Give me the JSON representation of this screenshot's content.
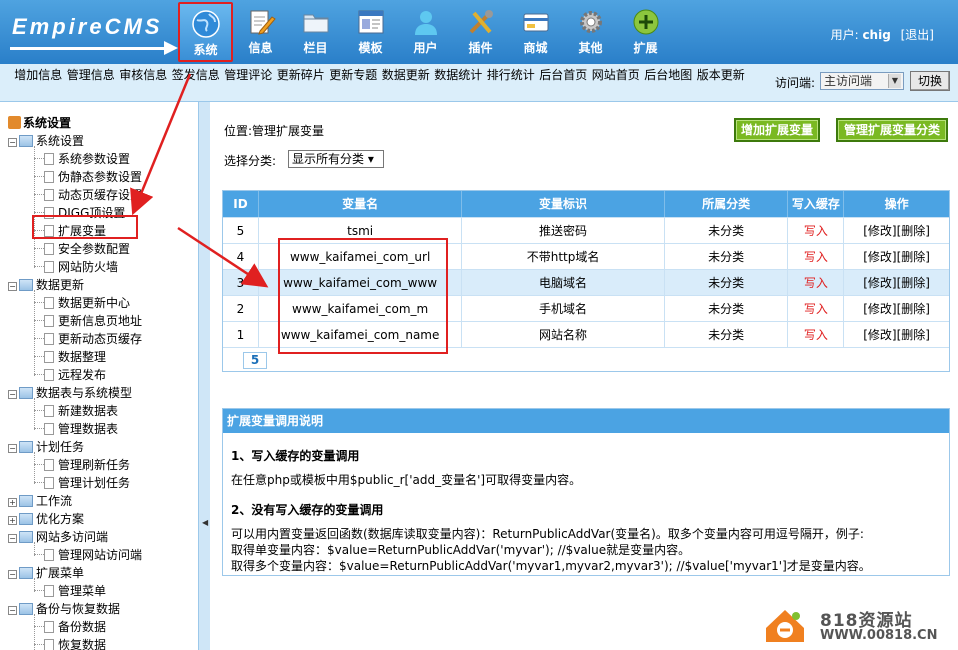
{
  "header": {
    "logo_text": "EmpireCMS",
    "nav": [
      {
        "label": "系统",
        "icon": "globe-icon",
        "active": true
      },
      {
        "label": "信息",
        "icon": "document-pencil-icon"
      },
      {
        "label": "栏目",
        "icon": "folder-icon"
      },
      {
        "label": "模板",
        "icon": "window-icon"
      },
      {
        "label": "用户",
        "icon": "user-icon"
      },
      {
        "label": "插件",
        "icon": "tools-icon"
      },
      {
        "label": "商城",
        "icon": "shop-card-icon"
      },
      {
        "label": "其他",
        "icon": "gear-icon"
      },
      {
        "label": "扩展",
        "icon": "plus-circle-icon"
      }
    ],
    "user_label": "用户:",
    "user_name": "chig",
    "logout": "[退出]"
  },
  "subbar": {
    "items": [
      "增加信息",
      "管理信息",
      "审核信息",
      "签发信息",
      "管理评论",
      "更新碎片",
      "更新专题",
      "数据更新",
      "数据统计",
      "排行统计",
      "后台首页",
      "网站首页",
      "后台地图",
      "版本更新"
    ],
    "visit_label": "访问端:",
    "visit_value": "主访问端",
    "switch": "切换"
  },
  "sidebar": {
    "root": "系统设置",
    "groups": [
      {
        "label": "系统设置",
        "items": [
          "系统参数设置",
          "伪静态参数设置",
          "动态页缓存设置",
          "DIGG顶设置",
          "扩展变量",
          "安全参数配置",
          "网站防火墙"
        ]
      },
      {
        "label": "数据更新",
        "items": [
          "数据更新中心",
          "更新信息页地址",
          "更新动态页缓存",
          "数据整理",
          "远程发布"
        ]
      },
      {
        "label": "数据表与系统模型",
        "items": [
          "新建数据表",
          "管理数据表"
        ]
      },
      {
        "label": "计划任务",
        "items": [
          "管理刷新任务",
          "管理计划任务"
        ]
      },
      {
        "label": "工作流",
        "items": []
      },
      {
        "label": "优化方案",
        "items": []
      },
      {
        "label": "网站多访问端",
        "items": [
          "管理网站访问端"
        ]
      },
      {
        "label": "扩展菜单",
        "items": [
          "管理菜单"
        ]
      },
      {
        "label": "备份与恢复数据",
        "items": [
          "备份数据",
          "恢复数据",
          "管理备份目录"
        ]
      }
    ]
  },
  "main": {
    "location_label": "位置:",
    "location_link": "管理扩展变量",
    "category_label": "选择分类:",
    "category_value": "显示所有分类",
    "add_button": "增加扩展变量",
    "manage_category_button": "管理扩展变量分类",
    "columns": [
      "ID",
      "变量名",
      "变量标识",
      "所属分类",
      "写入缓存",
      "操作"
    ],
    "rows": [
      {
        "id": "5",
        "name": "tsmi",
        "label": "推送密码",
        "category": "未分类",
        "cache": "写入",
        "edit": "[修改]",
        "delete": "[删除]"
      },
      {
        "id": "4",
        "name": "www_kaifamei_com_url",
        "label": "不带http域名",
        "category": "未分类",
        "cache": "写入",
        "edit": "[修改]",
        "delete": "[删除]"
      },
      {
        "id": "3",
        "name": "www_kaifamei_com_www",
        "label": "电脑域名",
        "category": "未分类",
        "cache": "写入",
        "edit": "[修改]",
        "delete": "[删除]"
      },
      {
        "id": "2",
        "name": "www_kaifamei_com_m",
        "label": "手机域名",
        "category": "未分类",
        "cache": "写入",
        "edit": "[修改]",
        "delete": "[删除]"
      },
      {
        "id": "1",
        "name": "www_kaifamei_com_name",
        "label": "网站名称",
        "category": "未分类",
        "cache": "写入",
        "edit": "[修改]",
        "delete": "[删除]"
      }
    ],
    "pager": "5",
    "help": {
      "title": "扩展变量调用说明",
      "h1": "1、写入缓存的变量调用",
      "p1": "在任意php或模板中用$public_r['add_变量名']可取得变量内容。",
      "h2": "2、没有写入缓存的变量调用",
      "p2": "可以用内置变量返回函数(数据库读取变量内容)：ReturnPublicAddVar(变量名)。取多个变量内容可用逗号隔开，例子:",
      "p3": "取得单变量内容：$value=ReturnPublicAddVar('myvar'); //$value就是变量内容。",
      "p4": "取得多个变量内容：$value=ReturnPublicAddVar('myvar1,myvar2,myvar3'); //$value['myvar1']才是变量内容。"
    }
  },
  "watermark": {
    "line1": "818资源站",
    "line2": "WWW.00818.CN"
  },
  "colors": {
    "header": "#2a7fc9",
    "table_header": "#4ba3e3",
    "green_button": "#7ab922",
    "annotation": "#e02020"
  }
}
